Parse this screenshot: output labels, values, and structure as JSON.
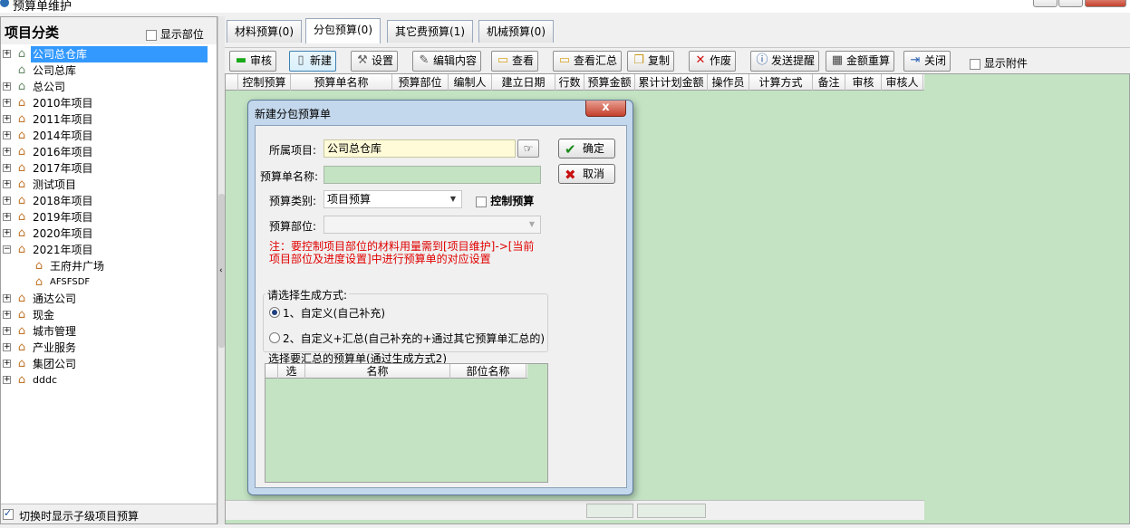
{
  "window": {
    "title": "预算单维护"
  },
  "left_panel": {
    "title": "项目分类",
    "show_dept_label": "显示部位",
    "footer_label": "切换时显示子级项目预算",
    "tree": [
      {
        "label": "公司总仓库",
        "selected": true
      },
      {
        "label": "公司总库"
      },
      {
        "label": "总公司"
      },
      {
        "label": "2010年项目"
      },
      {
        "label": "2011年项目"
      },
      {
        "label": "2014年项目"
      },
      {
        "label": "2016年项目"
      },
      {
        "label": "2017年项目"
      },
      {
        "label": "测试项目"
      },
      {
        "label": "2018年项目"
      },
      {
        "label": "2019年项目"
      },
      {
        "label": "2020年项目"
      },
      {
        "label": "2021年项目"
      },
      {
        "label": "王府井广场"
      },
      {
        "label": "AFSFSDF"
      },
      {
        "label": "通达公司"
      },
      {
        "label": "现金"
      },
      {
        "label": "城市管理"
      },
      {
        "label": "产业服务"
      },
      {
        "label": "集团公司"
      },
      {
        "label": "dddc"
      }
    ]
  },
  "tabs": [
    {
      "label": "材料预算(0)"
    },
    {
      "label": "分包预算(0)"
    },
    {
      "label": "其它费预算(1)"
    },
    {
      "label": "机械预算(0)"
    }
  ],
  "toolbar": {
    "audit": "审核",
    "new": "新建",
    "settings": "设置",
    "edit": "编辑内容",
    "view": "查看",
    "view_summary": "查看汇总",
    "copy": "复制",
    "void": "作废",
    "send_reminder": "发送提醒",
    "recalc": "金额重算",
    "close": "关闭",
    "show_attach": "显示附件"
  },
  "grid_columns": [
    "控制预算",
    "预算单名称",
    "预算部位",
    "编制人",
    "建立日期",
    "行数",
    "预算金额",
    "累计计划金额",
    "操作员",
    "计算方式",
    "备注",
    "审核",
    "审核人"
  ],
  "dialog": {
    "title": "新建分包预算单",
    "close_glyph": "x",
    "project_label": "所属项目:",
    "project_value": "公司总仓库",
    "name_label": "预算单名称:",
    "name_value": "",
    "category_label": "预算类别:",
    "category_value": "项目预算",
    "control_label": "控制预算",
    "dept_label": "预算部位:",
    "dept_value": "",
    "ok": "确定",
    "cancel": "取消",
    "note_line1": "注：要控制项目部位的材料用量需到[项目维护]->[当前",
    "note_line2": "项目部位及进度设置]中进行预算单的对应设置",
    "gen_title": "请选择生成方式:",
    "option1": "1、自定义(自己补充)",
    "option2": "2、自定义+汇总(自己补充的+通过其它预算单汇总的)",
    "summary_title": "选择要汇总的预算单(通过生成方式2)",
    "sub_columns": [
      "选",
      "名称",
      "部位名称"
    ]
  }
}
